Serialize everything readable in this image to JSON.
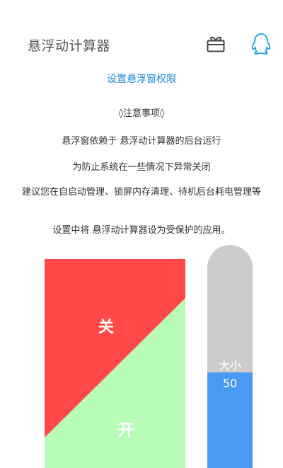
{
  "header": {
    "title": "悬浮动计算器",
    "gift_icon": "gift-icon",
    "qq_icon": "qq-penguin-icon"
  },
  "permission_link": "设置悬浮窗权限",
  "notes": {
    "title": "◊注意事项◊",
    "lines": [
      "悬浮窗依赖于 悬浮动计算器的后台运行",
      "为防止系统在一些情况下异常关闭",
      "建议您在自启动管理、锁屏内存清理、待机后台耗电管理等",
      "设置中将 悬浮动计算器设为受保护的应用。"
    ]
  },
  "toggle": {
    "off_label": "关",
    "on_label": "开",
    "off_color": "#ff4848",
    "on_color": "#b8fcb8"
  },
  "size_slider": {
    "label": "大小",
    "value": "50",
    "fill_fraction": 0.43,
    "track_color": "#cccccc",
    "fill_color": "#4a9af4"
  },
  "colors": {
    "link": "#1e88d8",
    "qq_icon": "#2aa8e0"
  }
}
